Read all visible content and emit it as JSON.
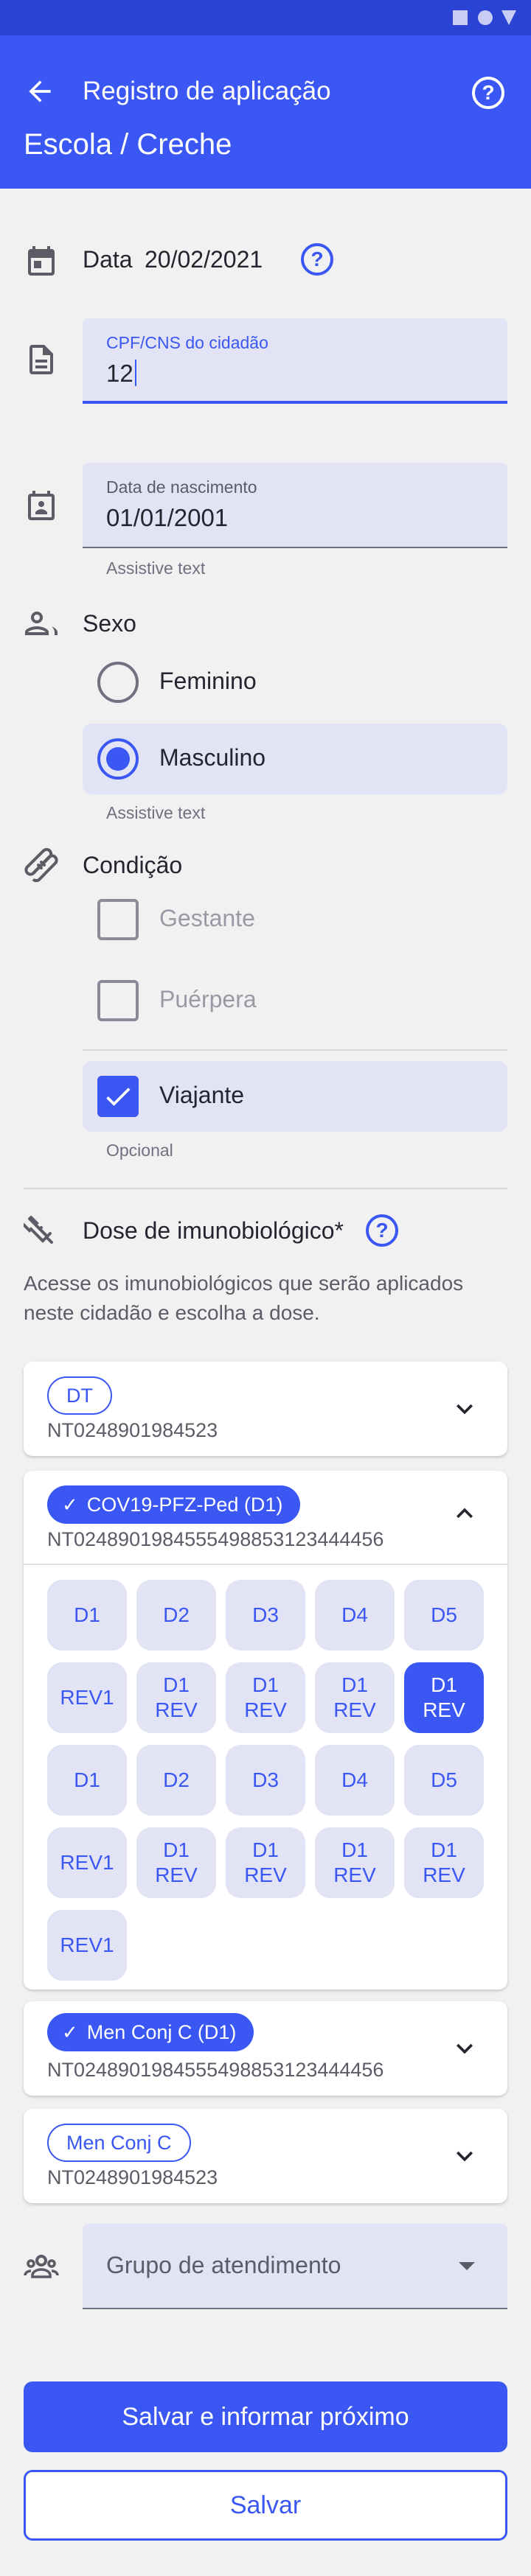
{
  "appbar": {
    "title": "Registro de aplicação",
    "subtitle": "Escola / Creche",
    "help_icon": "?"
  },
  "date": {
    "label": "Data",
    "value": "20/02/2021",
    "help_icon": "?"
  },
  "cpf": {
    "label": "CPF/CNS do cidadão",
    "value": "12"
  },
  "birth": {
    "label": "Data de nascimento",
    "value": "01/01/2001",
    "helper": "Assistive text"
  },
  "sex": {
    "label": "Sexo",
    "options": [
      "Feminino",
      "Masculino"
    ],
    "selected": "Masculino",
    "helper": "Assistive text"
  },
  "condition": {
    "label": "Condição",
    "options": [
      {
        "label": "Gestante",
        "checked": false
      },
      {
        "label": "Puérpera",
        "checked": false
      },
      {
        "label": "Viajante",
        "checked": true
      }
    ],
    "helper": "Opcional"
  },
  "dose": {
    "label": "Dose de imunobiológico*",
    "help_icon": "?",
    "description": "Acesse os imunobiológicos que serão aplicados neste cidadão e escolha a dose.",
    "cards": [
      {
        "chip": "DT",
        "lot": "NT0248901984523",
        "state": "collapsed",
        "selected": false
      },
      {
        "chip": "COV19-PFZ-Ped (D1)",
        "lot": "NT024890198455549885312344 4456",
        "state": "expanded",
        "selected": true
      },
      {
        "chip": "Men Conj C (D1)",
        "lot": "NT0248901984555498853123444456",
        "state": "collapsed",
        "selected": true
      },
      {
        "chip": "Men Conj C",
        "lot": "NT0248901984523",
        "state": "collapsed",
        "selected": false
      }
    ],
    "dose_options": [
      [
        "D1",
        "D2",
        "D3",
        "D4",
        "D5"
      ],
      [
        "REV1",
        "D1 REV",
        "D1 REV",
        "D1 REV",
        "D1 REV"
      ],
      [
        "D1",
        "D2",
        "D3",
        "D4",
        "D5"
      ],
      [
        "REV1",
        "D1 REV",
        "D1 REV",
        "D1 REV",
        "D1 REV"
      ],
      [
        "REV1"
      ]
    ],
    "active_dose": "row 2, column 5"
  },
  "group": {
    "placeholder": "Grupo de atendimento"
  },
  "actions": {
    "primary": "Salvar e informar próximo",
    "secondary": "Salvar"
  },
  "colors": {
    "primary": "#3a57f3",
    "background": "#f1f1f1",
    "field": "#e2e4f6"
  }
}
